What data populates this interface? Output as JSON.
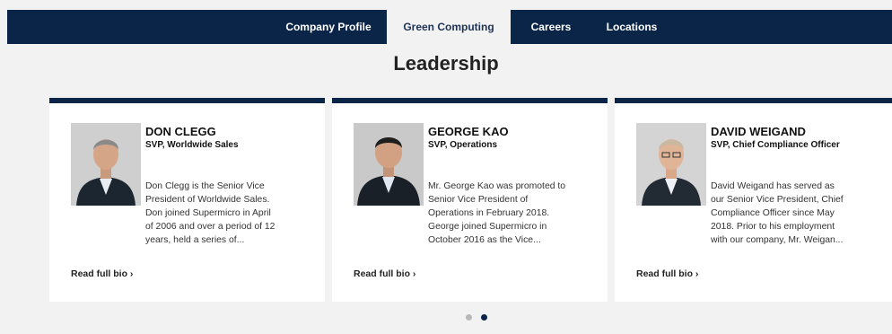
{
  "nav": {
    "tabs": [
      {
        "label": "Company Profile"
      },
      {
        "label": "Green Computing"
      },
      {
        "label": "Careers"
      },
      {
        "label": "Locations"
      }
    ],
    "active_tab": "Green Computing"
  },
  "page": {
    "title": "Leadership"
  },
  "cards": [
    {
      "name": "DON CLEGG",
      "role": "SVP, Worldwide Sales",
      "bio_lines": [
        "Don Clegg is the Senior Vice",
        "President of Worldwide Sales.",
        "Don joined Supermicro in April",
        "of 2006 and over a period of 12",
        "years, held a series of..."
      ],
      "read_more": "Read full bio ›"
    },
    {
      "name": "GEORGE KAO",
      "role": "SVP, Operations",
      "bio_lines": [
        "Mr. George Kao was promoted to",
        "Senior Vice President of",
        "Operations in February 2018.",
        "George joined Supermicro in",
        "October 2016 as the Vice..."
      ],
      "read_more": "Read full bio ›"
    },
    {
      "name": "DAVID WEIGAND",
      "role": "SVP, Chief Compliance Officer",
      "bio_lines": [
        "David Weigand has served as",
        "our Senior Vice President, Chief",
        "Compliance Officer since May",
        "2018. Prior to his employment",
        "with our company, Mr. Weigan..."
      ],
      "read_more": "Read full bio ›"
    }
  ],
  "pager": {
    "pages": 2,
    "current_page": 2
  },
  "colors": {
    "nav_bg": "#0b2548",
    "page_bg": "#f2f2f2",
    "card_accent": "#0b2548",
    "dot_active": "#0b2548",
    "dot_inactive": "#b8b8b8"
  }
}
